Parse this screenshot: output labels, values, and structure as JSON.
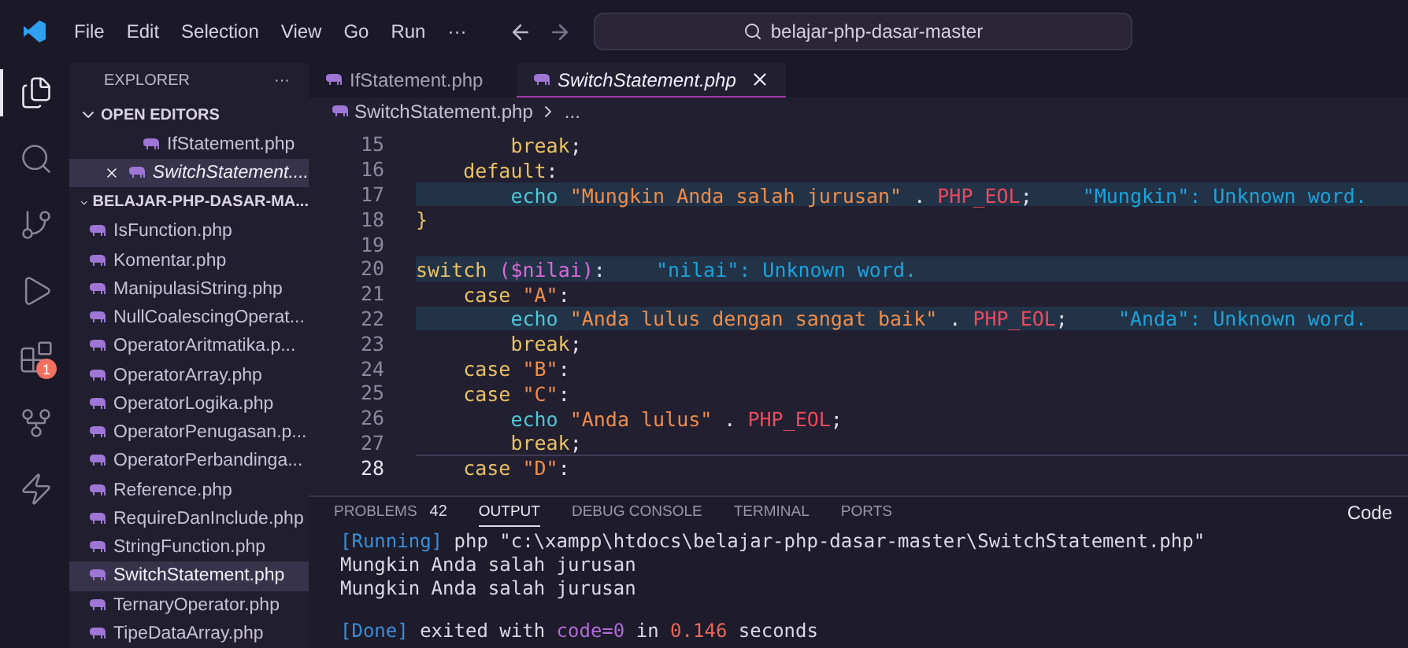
{
  "menu": [
    "File",
    "Edit",
    "Selection",
    "View",
    "Go",
    "Run",
    "···"
  ],
  "search": {
    "value": "belajar-php-dasar-master"
  },
  "activity": [
    {
      "kind": "files",
      "selected": true
    },
    {
      "kind": "search",
      "selected": false
    },
    {
      "kind": "source-control",
      "selected": false
    },
    {
      "kind": "run",
      "selected": false
    },
    {
      "kind": "extensions",
      "selected": false,
      "badge": "1"
    },
    {
      "kind": "git-graph",
      "selected": false
    },
    {
      "kind": "bolt",
      "selected": false
    }
  ],
  "explorer": {
    "title": "EXPLORER",
    "more": "···",
    "open_editors": {
      "title": "OPEN EDITORS",
      "expanded": true,
      "items": [
        {
          "name": "IfStatement.php",
          "selected": false,
          "italic": false
        },
        {
          "name": "SwitchStatement....",
          "selected": true,
          "italic": true
        }
      ]
    },
    "folder": {
      "title": "BELAJAR-PHP-DASAR-MA...",
      "expanded": true,
      "items": [
        {
          "name": "IsFunction.php",
          "selected": false
        },
        {
          "name": "Komentar.php",
          "selected": false
        },
        {
          "name": "ManipulasiString.php",
          "selected": false
        },
        {
          "name": "NullCoalescingOperat...",
          "selected": false
        },
        {
          "name": "OperatorAritmatika.p...",
          "selected": false
        },
        {
          "name": "OperatorArray.php",
          "selected": false
        },
        {
          "name": "OperatorLogika.php",
          "selected": false
        },
        {
          "name": "OperatorPenugasan.p...",
          "selected": false
        },
        {
          "name": "OperatorPerbandinga...",
          "selected": false
        },
        {
          "name": "Reference.php",
          "selected": false
        },
        {
          "name": "RequireDanInclude.php",
          "selected": false
        },
        {
          "name": "StringFunction.php",
          "selected": false
        },
        {
          "name": "SwitchStatement.php",
          "selected": true
        },
        {
          "name": "TernaryOperator.php",
          "selected": false
        },
        {
          "name": "TipeDataArray.php",
          "selected": false
        }
      ]
    }
  },
  "tabs": [
    {
      "label": "IfStatement.php",
      "selected": false
    },
    {
      "label": "SwitchStatement.php",
      "selected": true
    }
  ],
  "breadcrumb": {
    "file": "SwitchStatement.php",
    "rest": "..."
  },
  "code": [
    {
      "number": "15",
      "highlighted": false,
      "current": false,
      "tokens": [
        {
          "kind": "keyword",
          "text": "        break"
        },
        {
          "kind": "punct",
          "text": ";"
        }
      ]
    },
    {
      "number": "16",
      "highlighted": false,
      "current": false,
      "tokens": [
        {
          "kind": "keyword",
          "text": "    default"
        },
        {
          "kind": "punct",
          "text": ":"
        }
      ]
    },
    {
      "number": "17",
      "highlighted": true,
      "current": false,
      "tokens": [
        {
          "kind": "echo",
          "text": "        echo "
        },
        {
          "kind": "string",
          "text": "\"Mungkin Anda salah jurusan\""
        },
        {
          "kind": "punct",
          "text": " . "
        },
        {
          "kind": "const",
          "text": "PHP_EOL"
        },
        {
          "kind": "punct",
          "text": ";"
        },
        {
          "kind": "diag",
          "text": "\"Mungkin\": Unknown word."
        }
      ]
    },
    {
      "number": "18",
      "highlighted": false,
      "current": false,
      "tokens": [
        {
          "kind": "keyword",
          "text": "}"
        }
      ]
    },
    {
      "number": "19",
      "highlighted": false,
      "current": false
    },
    {
      "number": "20",
      "highlighted": true,
      "current": false,
      "tokens": [
        {
          "kind": "keyword",
          "text": "switch "
        },
        {
          "kind": "var",
          "text": "($nilai)"
        },
        {
          "kind": "punct",
          "text": ":"
        },
        {
          "kind": "diag",
          "text": "\"nilai\": Unknown word."
        }
      ]
    },
    {
      "number": "21",
      "highlighted": false,
      "current": false,
      "tokens": [
        {
          "kind": "keyword",
          "text": "    case "
        },
        {
          "kind": "string",
          "text": "\"A\""
        },
        {
          "kind": "punct",
          "text": ":"
        }
      ]
    },
    {
      "number": "22",
      "highlighted": true,
      "current": false,
      "tokens": [
        {
          "kind": "echo",
          "text": "        echo "
        },
        {
          "kind": "string",
          "text": "\"Anda lulus dengan sangat baik\""
        },
        {
          "kind": "punct",
          "text": " . "
        },
        {
          "kind": "const",
          "text": "PHP_EOL"
        },
        {
          "kind": "punct",
          "text": ";"
        },
        {
          "kind": "diag",
          "text": "\"Anda\": Unknown word."
        }
      ]
    },
    {
      "number": "23",
      "highlighted": false,
      "current": false,
      "tokens": [
        {
          "kind": "keyword",
          "text": "        break"
        },
        {
          "kind": "punct",
          "text": ";"
        }
      ]
    },
    {
      "number": "24",
      "highlighted": false,
      "current": false,
      "tokens": [
        {
          "kind": "keyword",
          "text": "    case "
        },
        {
          "kind": "string",
          "text": "\"B\""
        },
        {
          "kind": "punct",
          "text": ":"
        }
      ]
    },
    {
      "number": "25",
      "highlighted": false,
      "current": false,
      "tokens": [
        {
          "kind": "keyword",
          "text": "    case "
        },
        {
          "kind": "string",
          "text": "\"C\""
        },
        {
          "kind": "punct",
          "text": ":"
        }
      ]
    },
    {
      "number": "26",
      "highlighted": false,
      "current": false,
      "tokens": [
        {
          "kind": "echo",
          "text": "        echo "
        },
        {
          "kind": "string",
          "text": "\"Anda lulus\""
        },
        {
          "kind": "punct",
          "text": " . "
        },
        {
          "kind": "const",
          "text": "PHP_EOL"
        },
        {
          "kind": "punct",
          "text": ";"
        }
      ]
    },
    {
      "number": "27",
      "highlighted": false,
      "current": false,
      "tokens": [
        {
          "kind": "keyword",
          "text": "        break"
        },
        {
          "kind": "punct",
          "text": ";"
        }
      ]
    },
    {
      "number": "28",
      "highlighted": false,
      "current": true,
      "tokens": [
        {
          "kind": "keyword",
          "text": "    case "
        },
        {
          "kind": "string",
          "text": "\"D\""
        },
        {
          "kind": "punct",
          "text": ":"
        }
      ]
    }
  ],
  "panel": {
    "tabs": [
      {
        "label": "PROBLEMS",
        "count": "42",
        "selected": false
      },
      {
        "label": "OUTPUT",
        "selected": true
      },
      {
        "label": "DEBUG CONSOLE",
        "selected": false
      },
      {
        "label": "TERMINAL",
        "selected": false
      },
      {
        "label": "PORTS",
        "selected": false
      }
    ],
    "channel": "Code",
    "output": [
      {
        "tokens": [
          {
            "kind": "tag",
            "text": "[Running]"
          },
          {
            "kind": "plain",
            "text": " php \"c:\\xampp\\htdocs\\belajar-php-dasar-master\\SwitchStatement.php\""
          }
        ]
      },
      {
        "tokens": [
          {
            "kind": "plain",
            "text": "Mungkin Anda salah jurusan"
          }
        ]
      },
      {
        "tokens": [
          {
            "kind": "plain",
            "text": "Mungkin Anda salah jurusan"
          }
        ]
      },
      {
        "blank_before": true,
        "tokens": [
          {
            "kind": "tag",
            "text": "[Done]"
          },
          {
            "kind": "plain",
            "text": " exited with "
          },
          {
            "kind": "code",
            "text": "code=0"
          },
          {
            "kind": "plain",
            "text": " in "
          },
          {
            "kind": "number",
            "text": "0.146"
          },
          {
            "kind": "plain",
            "text": " seconds"
          }
        ]
      }
    ]
  }
}
